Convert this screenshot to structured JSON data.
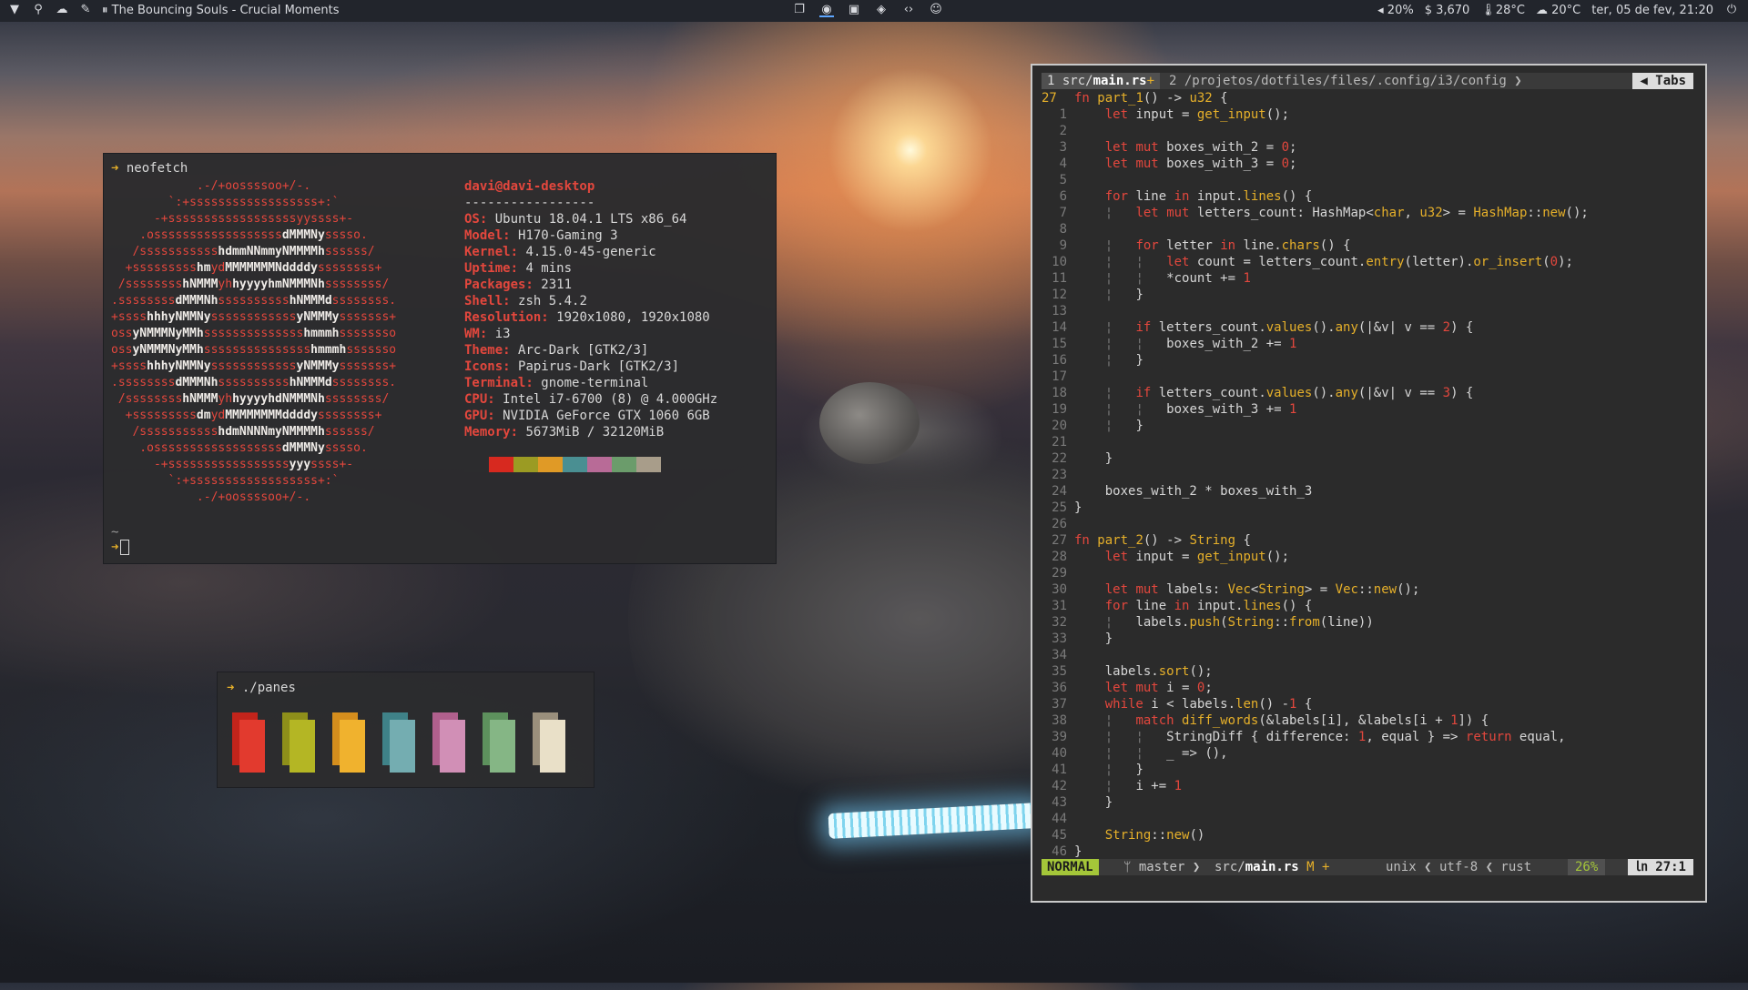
{
  "topbar": {
    "music": "⏸ The Bouncing Souls - Crucial Moments",
    "left_icons": [
      "wifi-icon",
      "location-icon",
      "cloud-icon",
      "pen-icon"
    ],
    "center_icons": [
      "window-icon",
      "chrome-icon",
      "terminal-icon",
      "compass-icon",
      "code-icon",
      "wechat-icon"
    ],
    "volume": "◂ 20%",
    "balance": "$ 3,670",
    "cpu_temp": "28°C",
    "weather": "20°C",
    "datetime": "ter, 05 de fev, 21:20",
    "power_icon": "power-icon"
  },
  "neofetch": {
    "command": "neofetch",
    "user": "davi@davi-desktop",
    "separator": "-----------------",
    "rows": [
      {
        "k": "OS",
        "v": "Ubuntu 18.04.1 LTS x86_64"
      },
      {
        "k": "Model",
        "v": "H170-Gaming 3"
      },
      {
        "k": "Kernel",
        "v": "4.15.0-45-generic"
      },
      {
        "k": "Uptime",
        "v": "4 mins"
      },
      {
        "k": "Packages",
        "v": "2311"
      },
      {
        "k": "Shell",
        "v": "zsh 5.4.2"
      },
      {
        "k": "Resolution",
        "v": "1920x1080, 1920x1080"
      },
      {
        "k": "WM",
        "v": "i3"
      },
      {
        "k": "Theme",
        "v": "Arc-Dark [GTK2/3]"
      },
      {
        "k": "Icons",
        "v": "Papirus-Dark [GTK2/3]"
      },
      {
        "k": "Terminal",
        "v": "gnome-terminal"
      },
      {
        "k": "CPU",
        "v": "Intel i7-6700 (8) @ 4.000GHz"
      },
      {
        "k": "GPU",
        "v": "NVIDIA GeForce GTX 1060 6GB"
      },
      {
        "k": "Memory",
        "v": "5673MiB / 32120MiB"
      }
    ],
    "swatches": [
      "#2c2c2e",
      "#d7291f",
      "#9b9b23",
      "#e09a26",
      "#4a8f92",
      "#b86b97",
      "#6b9c6b",
      "#a89d8a"
    ],
    "tilde": "~",
    "cursor": "▏"
  },
  "panes": {
    "command": "./panes",
    "colors": [
      {
        "back": "#c2241b",
        "front": "#e23a2e"
      },
      {
        "back": "#8e8f1a",
        "front": "#b4b624"
      },
      {
        "back": "#d58e1d",
        "front": "#f0b22e"
      },
      {
        "back": "#3f8288",
        "front": "#74adb1"
      },
      {
        "back": "#b0608d",
        "front": "#d18fb6"
      },
      {
        "back": "#5d915d",
        "front": "#85b685"
      },
      {
        "back": "#9a8f7c",
        "front": "#e9e0c8"
      }
    ]
  },
  "vim": {
    "tab1_num": "1 ",
    "tab1_dir": "src/",
    "tab1_file": "main.rs",
    "tab1_mod": "+",
    "tab2": "2 /projetos/dotfiles/files/.config/i3/config ❯",
    "tabs_label": "◀ Tabs",
    "status": {
      "mode": "NORMAL",
      "branch": "ᛘ master ❯",
      "file_dir": "src/",
      "file_name": "main.rs",
      "file_mod": " M +",
      "meta": "unix ❮ utf-8 ❮ rust",
      "pct": "26%",
      "pos": "㏑ 27:1"
    }
  }
}
